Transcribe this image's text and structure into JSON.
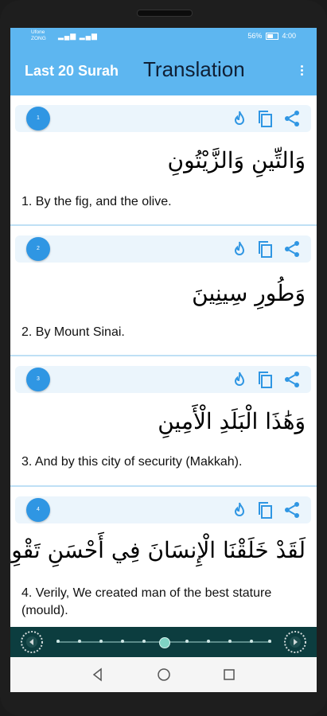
{
  "status_bar": {
    "carrier_1": "Ufone",
    "carrier_2": "ZONG",
    "battery_percent": "56%",
    "time": "4:00"
  },
  "app_bar": {
    "title": "Last 20 Surah",
    "subtitle": "Translation",
    "menu_icon": "more-vertical-icon"
  },
  "ayahs": [
    {
      "number": "1",
      "arabic": "وَالتِّينِ وَالزَّيْتُونِ",
      "translation": "1. By the fig, and the olive."
    },
    {
      "number": "2",
      "arabic": "وَطُورِ سِينِينَ",
      "translation": "2. By Mount Sinai."
    },
    {
      "number": "3",
      "arabic": "وَهَٰذَا الْبَلَدِ الْأَمِينِ",
      "translation": "3. And by this city of security (Makkah)."
    },
    {
      "number": "4",
      "arabic": "لَقَدْ خَلَقْنَا الْإِنسَانَ فِي أَحْسَنِ تَقْوِيمٍ",
      "translation": "4. Verily, We created man of the best stature (mould)."
    }
  ],
  "ayah_actions": [
    "fire-icon",
    "copy-icon",
    "share-icon"
  ],
  "player": {
    "prev_icon": "previous-icon",
    "next_icon": "next-icon",
    "progress": 0.5
  },
  "colors": {
    "app_bar": "#5db6f0",
    "ayah_number": "#2f96e3",
    "action_icon": "#2f96e3",
    "player_bg": "#0c3d3f"
  }
}
